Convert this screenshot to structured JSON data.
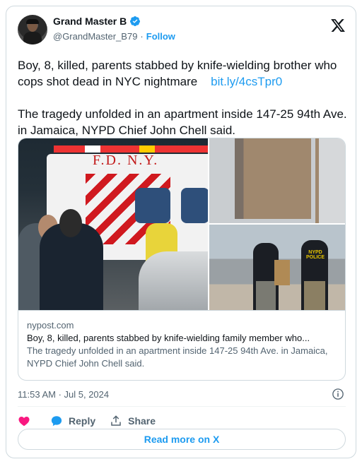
{
  "author": {
    "name": "Grand Master B",
    "handle": "@GrandMaster_B79",
    "separator": "·",
    "follow_label": "Follow"
  },
  "tweet": {
    "paragraph1": "Boy, 8, killed, parents stabbed by knife-wielding brother who cops shot dead in NYC nightmare",
    "link": "bit.ly/4csTpr0",
    "paragraph2": "The tragedy unfolded in an apartment inside 147-25 94th Ave. in Jamaica, NYPD Chief John Chell said."
  },
  "media": {
    "ambulance_text": "F.D.  N.Y.",
    "police_text": "NYPD POLICE",
    "domain": "nypost.com",
    "headline": "Boy, 8, killed, parents stabbed by knife-wielding family member who...",
    "description": "The tragedy unfolded in an apartment inside 147-25 94th Ave. in Jamaica, NYPD Chief John Chell said."
  },
  "timestamp": "11:53 AM · Jul 5, 2024",
  "actions": {
    "like_label": "",
    "reply_label": "Reply",
    "share_label": "Share"
  },
  "read_more_label": "Read more on X",
  "colors": {
    "accent": "#1d9bf0",
    "like": "#f91880",
    "text": "#0f1419",
    "muted": "#536471"
  },
  "icons": [
    "verified-icon",
    "x-logo-icon",
    "info-icon",
    "heart-icon",
    "reply-icon",
    "share-icon"
  ]
}
